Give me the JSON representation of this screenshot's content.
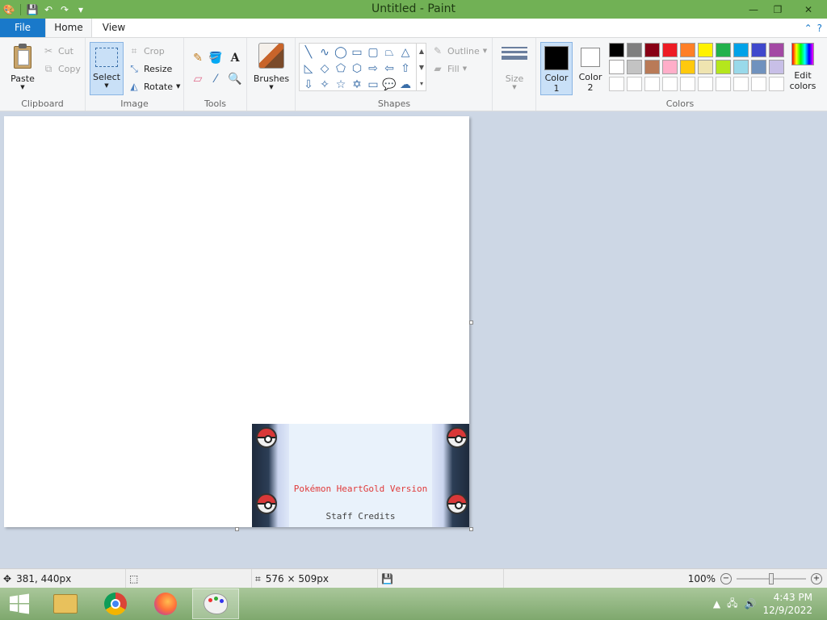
{
  "window": {
    "title": "Untitled - Paint",
    "min_icon": "minimize-icon",
    "max_icon": "restore-icon",
    "close_icon": "close-icon"
  },
  "tabs": {
    "file": "File",
    "home": "Home",
    "view": "View"
  },
  "ribbon": {
    "clipboard": {
      "label": "Clipboard",
      "paste": "Paste",
      "cut": "Cut",
      "copy": "Copy"
    },
    "image": {
      "label": "Image",
      "select": "Select",
      "crop": "Crop",
      "resize": "Resize",
      "rotate": "Rotate"
    },
    "tools": {
      "label": "Tools"
    },
    "brushes": {
      "label": "Brushes"
    },
    "shapes": {
      "label": "Shapes",
      "outline": "Outline",
      "fill": "Fill"
    },
    "size": {
      "label": "Size"
    },
    "colors": {
      "label": "Colors",
      "color1": "Color",
      "color1_num": "1",
      "color2": "Color",
      "color2_num": "2",
      "edit_colors_1": "Edit",
      "edit_colors_2": "colors",
      "palette_row1": [
        "#000000",
        "#7f7f7f",
        "#880015",
        "#ed1c24",
        "#ff7f27",
        "#fff200",
        "#22b14c",
        "#00a2e8",
        "#3f48cc",
        "#a349a4"
      ],
      "palette_row2": [
        "#ffffff",
        "#c3c3c3",
        "#b97a57",
        "#ffaec9",
        "#ffc90e",
        "#efe4b0",
        "#b5e61d",
        "#99d9ea",
        "#7092be",
        "#c8bfe7"
      ],
      "primary": "#000000",
      "secondary": "#ffffff"
    }
  },
  "canvas": {
    "pasted_title": "Pokémon HeartGold Version",
    "pasted_subtitle": "Staff Credits"
  },
  "status": {
    "cursor_pos": "381, 440px",
    "canvas_size": "576 × 509px",
    "zoom": "100%"
  },
  "taskbar": {
    "time": "4:43 PM",
    "date": "12/9/2022"
  }
}
